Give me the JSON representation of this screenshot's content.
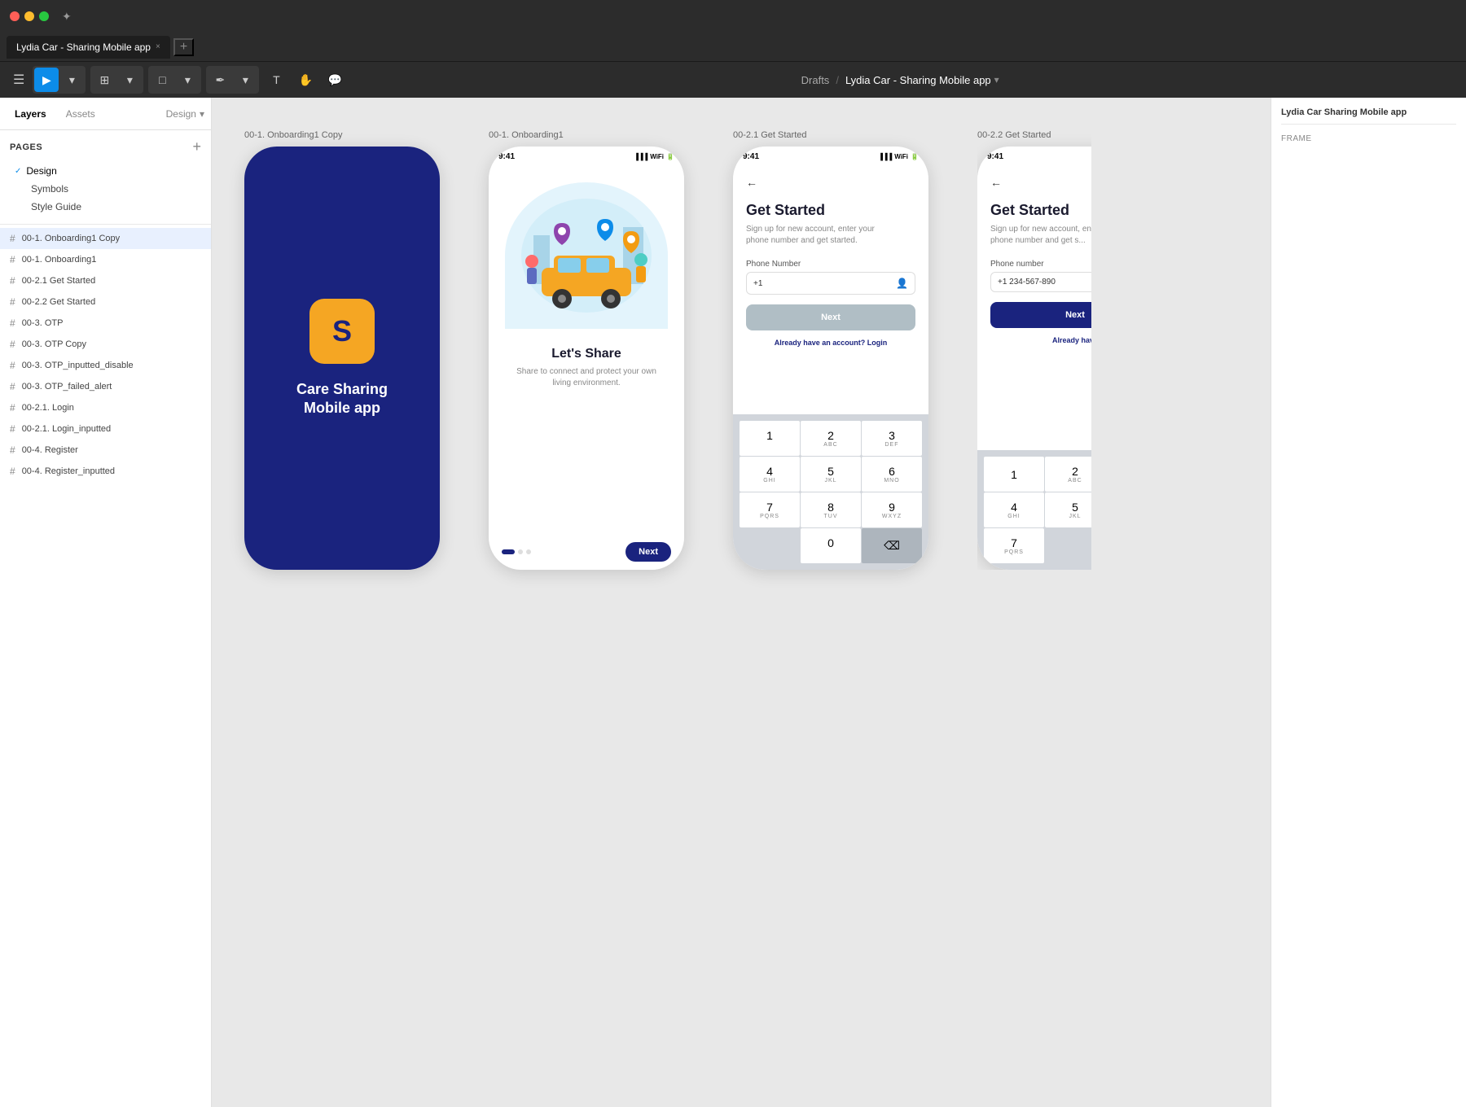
{
  "titleBar": {
    "tabTitle": "Lydia Car - Sharing Mobile app",
    "tabClose": "×",
    "tabAdd": "+"
  },
  "toolbar": {
    "breadcrumb": "Drafts",
    "separator": "/",
    "currentFile": "Lydia Car - Sharing Mobile app",
    "dropdownIcon": "▾"
  },
  "sidebar": {
    "tabs": {
      "layers": "Layers",
      "assets": "Assets",
      "design": "Design"
    },
    "pagesSection": {
      "title": "PAGES",
      "addIcon": "+"
    },
    "pages": [
      {
        "label": "Design",
        "active": true,
        "hasCheck": true
      },
      {
        "label": "Symbols",
        "active": false
      },
      {
        "label": "Style Guide",
        "active": false
      }
    ],
    "layers": [
      {
        "label": "00-1. Onboarding1 Copy",
        "active": true
      },
      {
        "label": "00-1. Onboarding1"
      },
      {
        "label": "00-2.1 Get Started"
      },
      {
        "label": "00-2.2 Get Started"
      },
      {
        "label": "00-3. OTP"
      },
      {
        "label": "00-3. OTP Copy"
      },
      {
        "label": "00-3. OTP_inputted_disable"
      },
      {
        "label": "00-3. OTP_failed_alert"
      },
      {
        "label": "00-2.1. Login"
      },
      {
        "label": "00-2.1. Login_inputted"
      },
      {
        "label": "00-4. Register"
      },
      {
        "label": "00-4. Register_inputted"
      }
    ]
  },
  "canvas": {
    "frames": [
      {
        "name": "00-1. Onboarding1 Copy",
        "type": "onboarding_splash",
        "appIconLetter": "S",
        "appName": "Care Sharing\nMobile app"
      },
      {
        "name": "00-1. Onboarding1",
        "type": "onboarding_slide",
        "statusTime": "9:41",
        "slideTitle": "Let's Share",
        "slideDesc": "Share to connect and protect your own\nliving environment.",
        "nextLabel": "Next"
      },
      {
        "name": "00-2.1 Get Started",
        "type": "get_started",
        "statusTime": "9:41",
        "backArrow": "←",
        "title": "Get Started",
        "subtitle": "Sign up for new account, enter your\nphone number and get started.",
        "inputLabel": "Phone Number",
        "inputPlaceholder": "+1",
        "nextLabel": "Next",
        "loginText": "Already have an account?",
        "loginLink": "Login",
        "hasNumpad": true,
        "numpad": {
          "keys": [
            {
              "digit": "1",
              "letters": ""
            },
            {
              "digit": "2",
              "letters": "ABC"
            },
            {
              "digit": "3",
              "letters": "DEF"
            },
            {
              "digit": "4",
              "letters": "GHI"
            },
            {
              "digit": "5",
              "letters": "JKL"
            },
            {
              "digit": "6",
              "letters": "MNO"
            },
            {
              "digit": "7",
              "letters": "PQRS"
            },
            {
              "digit": "8",
              "letters": "TUV"
            },
            {
              "digit": "9",
              "letters": "WXYZ"
            },
            {
              "digit": "",
              "letters": ""
            },
            {
              "digit": "0",
              "letters": ""
            },
            {
              "digit": "⌫",
              "letters": ""
            }
          ]
        }
      },
      {
        "name": "00-2.2 Get Started",
        "type": "get_started_filled",
        "statusTime": "9:41",
        "backArrow": "←",
        "title": "Get Started",
        "subtitle": "Sign up for new account, enter your\nphone number and get started.",
        "inputLabel": "Phone number",
        "inputValue": "+1 234-567-890",
        "nextLabel": "Next",
        "loginText": "Already have",
        "hasNumpad": true,
        "partial": true
      }
    ]
  },
  "rightPanel": {
    "title": "Lydia Car Sharing Mobile app"
  }
}
